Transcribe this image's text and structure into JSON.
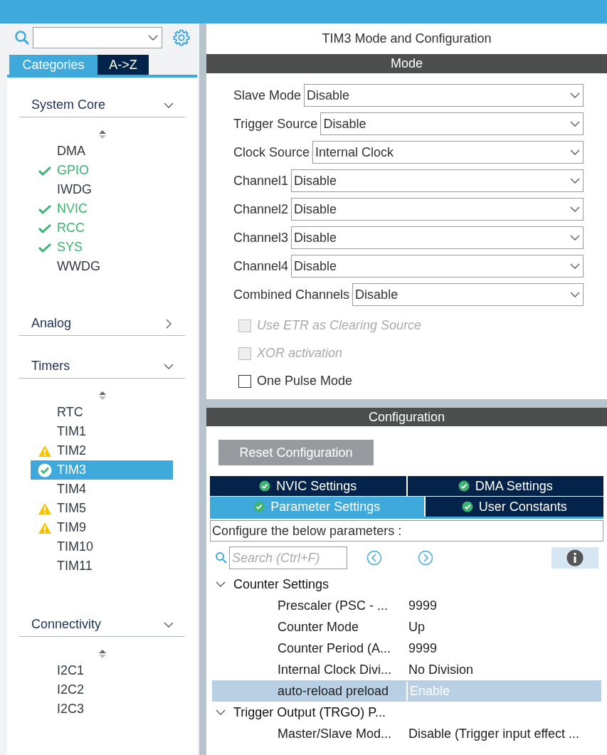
{
  "sidebar": {
    "tabs": [
      {
        "label": "Categories",
        "selected": true
      },
      {
        "label": "A->Z",
        "selected": false
      }
    ],
    "categories": [
      {
        "title": "System Core",
        "expanded": true,
        "items": [
          {
            "label": "DMA",
            "kind": "plain",
            "selected": false
          },
          {
            "label": "GPIO",
            "kind": "ok",
            "selected": false
          },
          {
            "label": "IWDG",
            "kind": "plain",
            "selected": false
          },
          {
            "label": "NVIC",
            "kind": "ok",
            "selected": false
          },
          {
            "label": "RCC",
            "kind": "ok",
            "selected": false
          },
          {
            "label": "SYS",
            "kind": "ok",
            "selected": false
          },
          {
            "label": "WWDG",
            "kind": "plain",
            "selected": false
          }
        ]
      },
      {
        "title": "Analog",
        "expanded": false
      },
      {
        "title": "Timers",
        "expanded": true,
        "items": [
          {
            "label": "RTC",
            "kind": "plain",
            "selected": false
          },
          {
            "label": "TIM1",
            "kind": "plain",
            "selected": false
          },
          {
            "label": "TIM2",
            "kind": "warning",
            "selected": false
          },
          {
            "label": "TIM3",
            "kind": "configured",
            "selected": true
          },
          {
            "label": "TIM4",
            "kind": "plain",
            "selected": false
          },
          {
            "label": "TIM5",
            "kind": "warning",
            "selected": false
          },
          {
            "label": "TIM9",
            "kind": "warning",
            "selected": false
          },
          {
            "label": "TIM10",
            "kind": "plain",
            "selected": false
          },
          {
            "label": "TIM11",
            "kind": "plain",
            "selected": false
          }
        ]
      },
      {
        "title": "Connectivity",
        "expanded": true,
        "items": [
          {
            "label": "I2C1",
            "kind": "plain",
            "selected": false
          },
          {
            "label": "I2C2",
            "kind": "plain",
            "selected": false
          },
          {
            "label": "I2C3",
            "kind": "plain",
            "selected": false
          }
        ]
      }
    ]
  },
  "panel": {
    "title": "TIM3 Mode and Configuration",
    "mode": {
      "heading": "Mode",
      "fields": [
        {
          "label": "Slave Mode",
          "value": "Disable"
        },
        {
          "label": "Trigger Source",
          "value": "Disable"
        },
        {
          "label": "Clock Source",
          "value": "Internal Clock"
        },
        {
          "label": "Channel1",
          "value": "Disable"
        },
        {
          "label": "Channel2",
          "value": "Disable"
        },
        {
          "label": "Channel3",
          "value": "Disable"
        },
        {
          "label": "Channel4",
          "value": "Disable"
        },
        {
          "label": "Combined Channels",
          "value": "Disable"
        }
      ],
      "checkboxes": [
        {
          "label": "Use ETR as Clearing Source",
          "checked": false,
          "disabled": true
        },
        {
          "label": "XOR activation",
          "checked": false,
          "disabled": true
        },
        {
          "label": "One Pulse Mode",
          "checked": false,
          "disabled": false
        }
      ]
    },
    "configuration": {
      "heading": "Configuration",
      "reset_button": "Reset Configuration",
      "tab_rows": [
        [
          {
            "label": "NVIC Settings",
            "selected": false
          },
          {
            "label": "DMA Settings",
            "selected": false
          }
        ],
        [
          {
            "label": "Parameter Settings",
            "selected": true
          },
          {
            "label": "User Constants",
            "selected": false
          }
        ]
      ],
      "description": "Configure the below parameters :",
      "search": {
        "placeholder": "Search (Ctrl+F)"
      },
      "groups": [
        {
          "title": "Counter Settings",
          "expanded": true,
          "params": [
            {
              "name": "Prescaler (PSC - ...",
              "value": "9999",
              "selected": false
            },
            {
              "name": "Counter Mode",
              "value": "Up",
              "selected": false
            },
            {
              "name": "Counter Period (A...",
              "value": "9999",
              "selected": false
            },
            {
              "name": "Internal Clock Divi...",
              "value": "No Division",
              "selected": false
            },
            {
              "name": "auto-reload preload",
              "value": "Enable",
              "selected": true
            }
          ]
        },
        {
          "title": "Trigger Output (TRGO) P...",
          "expanded": true,
          "params": [
            {
              "name": "Master/Slave Mod...",
              "value": "Disable (Trigger input effect ...",
              "selected": false
            }
          ]
        }
      ]
    }
  }
}
